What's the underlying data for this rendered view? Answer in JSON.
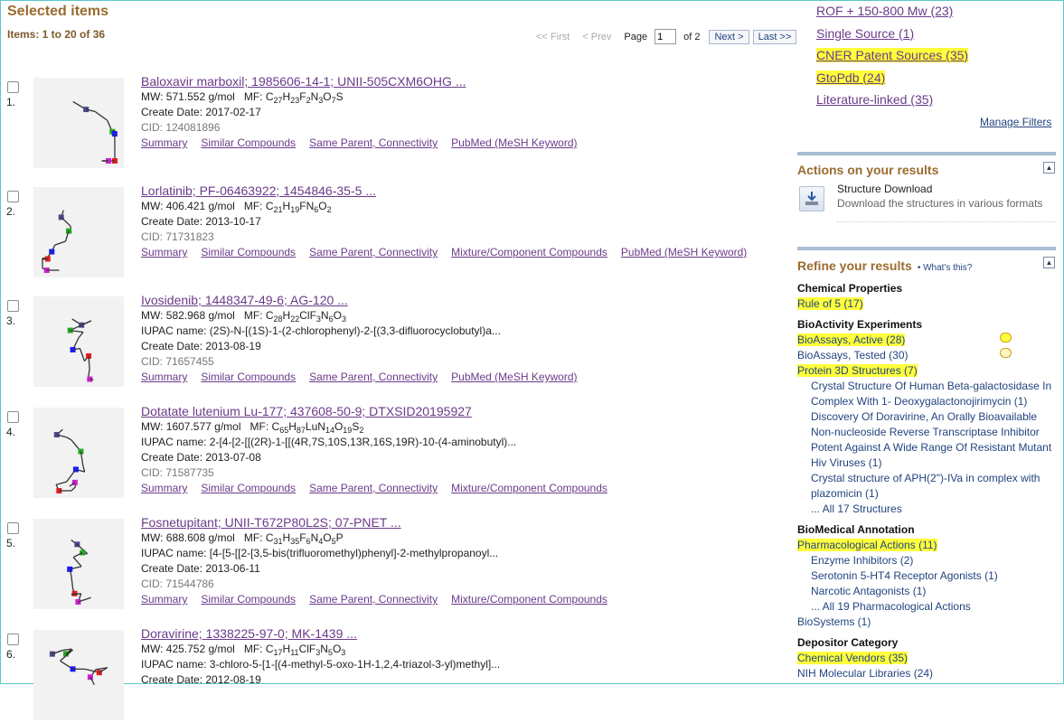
{
  "header": {
    "title": "Selected items",
    "items_count": "Items: 1 to 20 of 36"
  },
  "pager": {
    "first": "<< First",
    "prev": "< Prev",
    "page_label": "Page",
    "page_value": "1",
    "of_label": "of 2",
    "next": "Next >",
    "last": "Last >>"
  },
  "results": [
    {
      "num": "1.",
      "name": "Baloxavir marboxil; 1985606-14-1; UNII-505CXM6OHG ...",
      "mw": "MW: 571.552 g/mol",
      "mf_parts": [
        "C",
        "27",
        "H",
        "23",
        "F",
        "2",
        "N",
        "3",
        "O",
        "7",
        "S"
      ],
      "iupac": "",
      "date": "Create Date: 2017-02-17",
      "cid": "CID: 124081896",
      "links": [
        "Summary",
        "Similar Compounds",
        "Same Parent, Connectivity",
        "PubMed (MeSH Keyword)"
      ]
    },
    {
      "num": "2.",
      "name": "Lorlatinib; PF-06463922; 1454846-35-5 ...",
      "mw": "MW: 406.421 g/mol",
      "mf_parts": [
        "C",
        "21",
        "H",
        "19",
        "F",
        "",
        "N",
        "6",
        "O",
        "2"
      ],
      "iupac": "",
      "date": "Create Date: 2013-10-17",
      "cid": "CID: 71731823",
      "links": [
        "Summary",
        "Similar Compounds",
        "Same Parent, Connectivity",
        "Mixture/Component Compounds",
        "PubMed (MeSH Keyword)"
      ]
    },
    {
      "num": "3.",
      "name": "Ivosidenib; 1448347-49-6; AG-120 ...",
      "mw": "MW: 582.968 g/mol",
      "mf_parts": [
        "C",
        "28",
        "H",
        "22",
        "ClF",
        "3",
        "N",
        "6",
        "O",
        "3"
      ],
      "iupac": "IUPAC name: (2S)-N-[(1S)-1-(2-chlorophenyl)-2-[(3,3-difluorocyclobutyl)a...",
      "date": "Create Date: 2013-08-19",
      "cid": "CID: 71657455",
      "links": [
        "Summary",
        "Similar Compounds",
        "Same Parent, Connectivity",
        "PubMed (MeSH Keyword)"
      ]
    },
    {
      "num": "4.",
      "name": "Dotatate lutenium Lu-177; 437608-50-9; DTXSID20195927",
      "mw": "MW: 1607.577 g/mol",
      "mf_parts": [
        "C",
        "65",
        "H",
        "87",
        "LuN",
        "14",
        "O",
        "19",
        "S",
        "2"
      ],
      "iupac": "IUPAC name: 2-[4-[2-[[(2R)-1-[[(4R,7S,10S,13R,16S,19R)-10-(4-aminobutyl)...",
      "date": "Create Date: 2013-07-08",
      "cid": "CID: 71587735",
      "links": [
        "Summary",
        "Similar Compounds",
        "Same Parent, Connectivity",
        "Mixture/Component Compounds"
      ]
    },
    {
      "num": "5.",
      "name": "Fosnetupitant; UNII-T672P80L2S; 07-PNET ...",
      "mw": "MW: 688.608 g/mol",
      "mf_parts": [
        "C",
        "31",
        "H",
        "35",
        "F",
        "6",
        "N",
        "4",
        "O",
        "5",
        "P"
      ],
      "iupac": "IUPAC name: [4-[5-[[2-[3,5-bis(trifluoromethyl)phenyl]-2-methylpropanoyl...",
      "date": "Create Date: 2013-06-11",
      "cid": "CID: 71544786",
      "links": [
        "Summary",
        "Similar Compounds",
        "Same Parent, Connectivity",
        "Mixture/Component Compounds"
      ]
    },
    {
      "num": "6.",
      "name": "Doravirine; 1338225-97-0; MK-1439 ...",
      "mw": "MW: 425.752 g/mol",
      "mf_parts": [
        "C",
        "17",
        "H",
        "11",
        "ClF",
        "3",
        "N",
        "5",
        "O",
        "3"
      ],
      "iupac": "IUPAC name: 3-chloro-5-[1-[(4-methyl-5-oxo-1H-1,2,4-triazol-3-yl)methyl]...",
      "date": "Create Date: 2012-08-19",
      "cid": "",
      "links": []
    }
  ],
  "mf_label": "MF:",
  "filters": [
    {
      "label": "ROF + 150-800 Mw (23)",
      "highlight": false
    },
    {
      "label": "Single Source (1)",
      "highlight": false
    },
    {
      "label": "CNER Patent Sources (35)",
      "highlight": true
    },
    {
      "label": "GtoPdb (24)",
      "highlight": true
    },
    {
      "label": "Literature-linked (35)",
      "highlight": false
    }
  ],
  "manage_filters": "Manage Filters",
  "actions": {
    "title": "Actions on your results",
    "download_title": "Structure Download",
    "download_desc": "Download the structures in various formats",
    "collapse": "▲"
  },
  "refine": {
    "title": "Refine your results",
    "whats_this": "• What's this?",
    "collapse": "▲",
    "sections": [
      {
        "type": "h",
        "text": "Chemical Properties"
      },
      {
        "type": "it",
        "text": "Rule of 5 (17)",
        "hl": true
      },
      {
        "type": "gap"
      },
      {
        "type": "h",
        "text": "BioActivity Experiments"
      },
      {
        "type": "it",
        "text": "BioAssays, Active (28)",
        "hl": true,
        "ext": true
      },
      {
        "type": "it",
        "text": "BioAssays, Tested (30)",
        "hl": false,
        "ext": true
      },
      {
        "type": "it",
        "text": "Protein 3D Structures (7)",
        "hl": true
      },
      {
        "type": "sub",
        "text": "Crystal Structure Of Human Beta-galactosidase In"
      },
      {
        "type": "sub",
        "text": "Complex With 1- Deoxygalactonojirimycin (1)"
      },
      {
        "type": "sub",
        "text": "Discovery Of Doravirine, An Orally Bioavailable"
      },
      {
        "type": "sub",
        "text": "Non-nucleoside Reverse Transcriptase Inhibitor"
      },
      {
        "type": "sub",
        "text": "Potent Against A Wide Range Of Resistant Mutant"
      },
      {
        "type": "sub",
        "text": "Hiv Viruses (1)"
      },
      {
        "type": "sub",
        "text": "Crystal structure of APH(2\")-IVa in complex with"
      },
      {
        "type": "sub",
        "text": "plazomicin (1)"
      },
      {
        "type": "sub",
        "text": "... All 17 Structures"
      },
      {
        "type": "gap"
      },
      {
        "type": "h",
        "text": "BioMedical Annotation"
      },
      {
        "type": "it",
        "text": "Pharmacological Actions (11)",
        "hl": true
      },
      {
        "type": "sub",
        "text": "Enzyme Inhibitors (2)"
      },
      {
        "type": "sub",
        "text": "Serotonin 5-HT4 Receptor Agonists (1)"
      },
      {
        "type": "sub",
        "text": "Narcotic Antagonists (1)"
      },
      {
        "type": "sub",
        "text": "... All 19 Pharmacological Actions"
      },
      {
        "type": "it",
        "text": "BioSystems (1)",
        "hl": false
      },
      {
        "type": "gap"
      },
      {
        "type": "h",
        "text": "Depositor Category"
      },
      {
        "type": "it",
        "text": "Chemical Vendors (35)",
        "hl": true
      },
      {
        "type": "it",
        "text": "NIH Molecular Libraries (24)",
        "hl": false
      }
    ]
  }
}
